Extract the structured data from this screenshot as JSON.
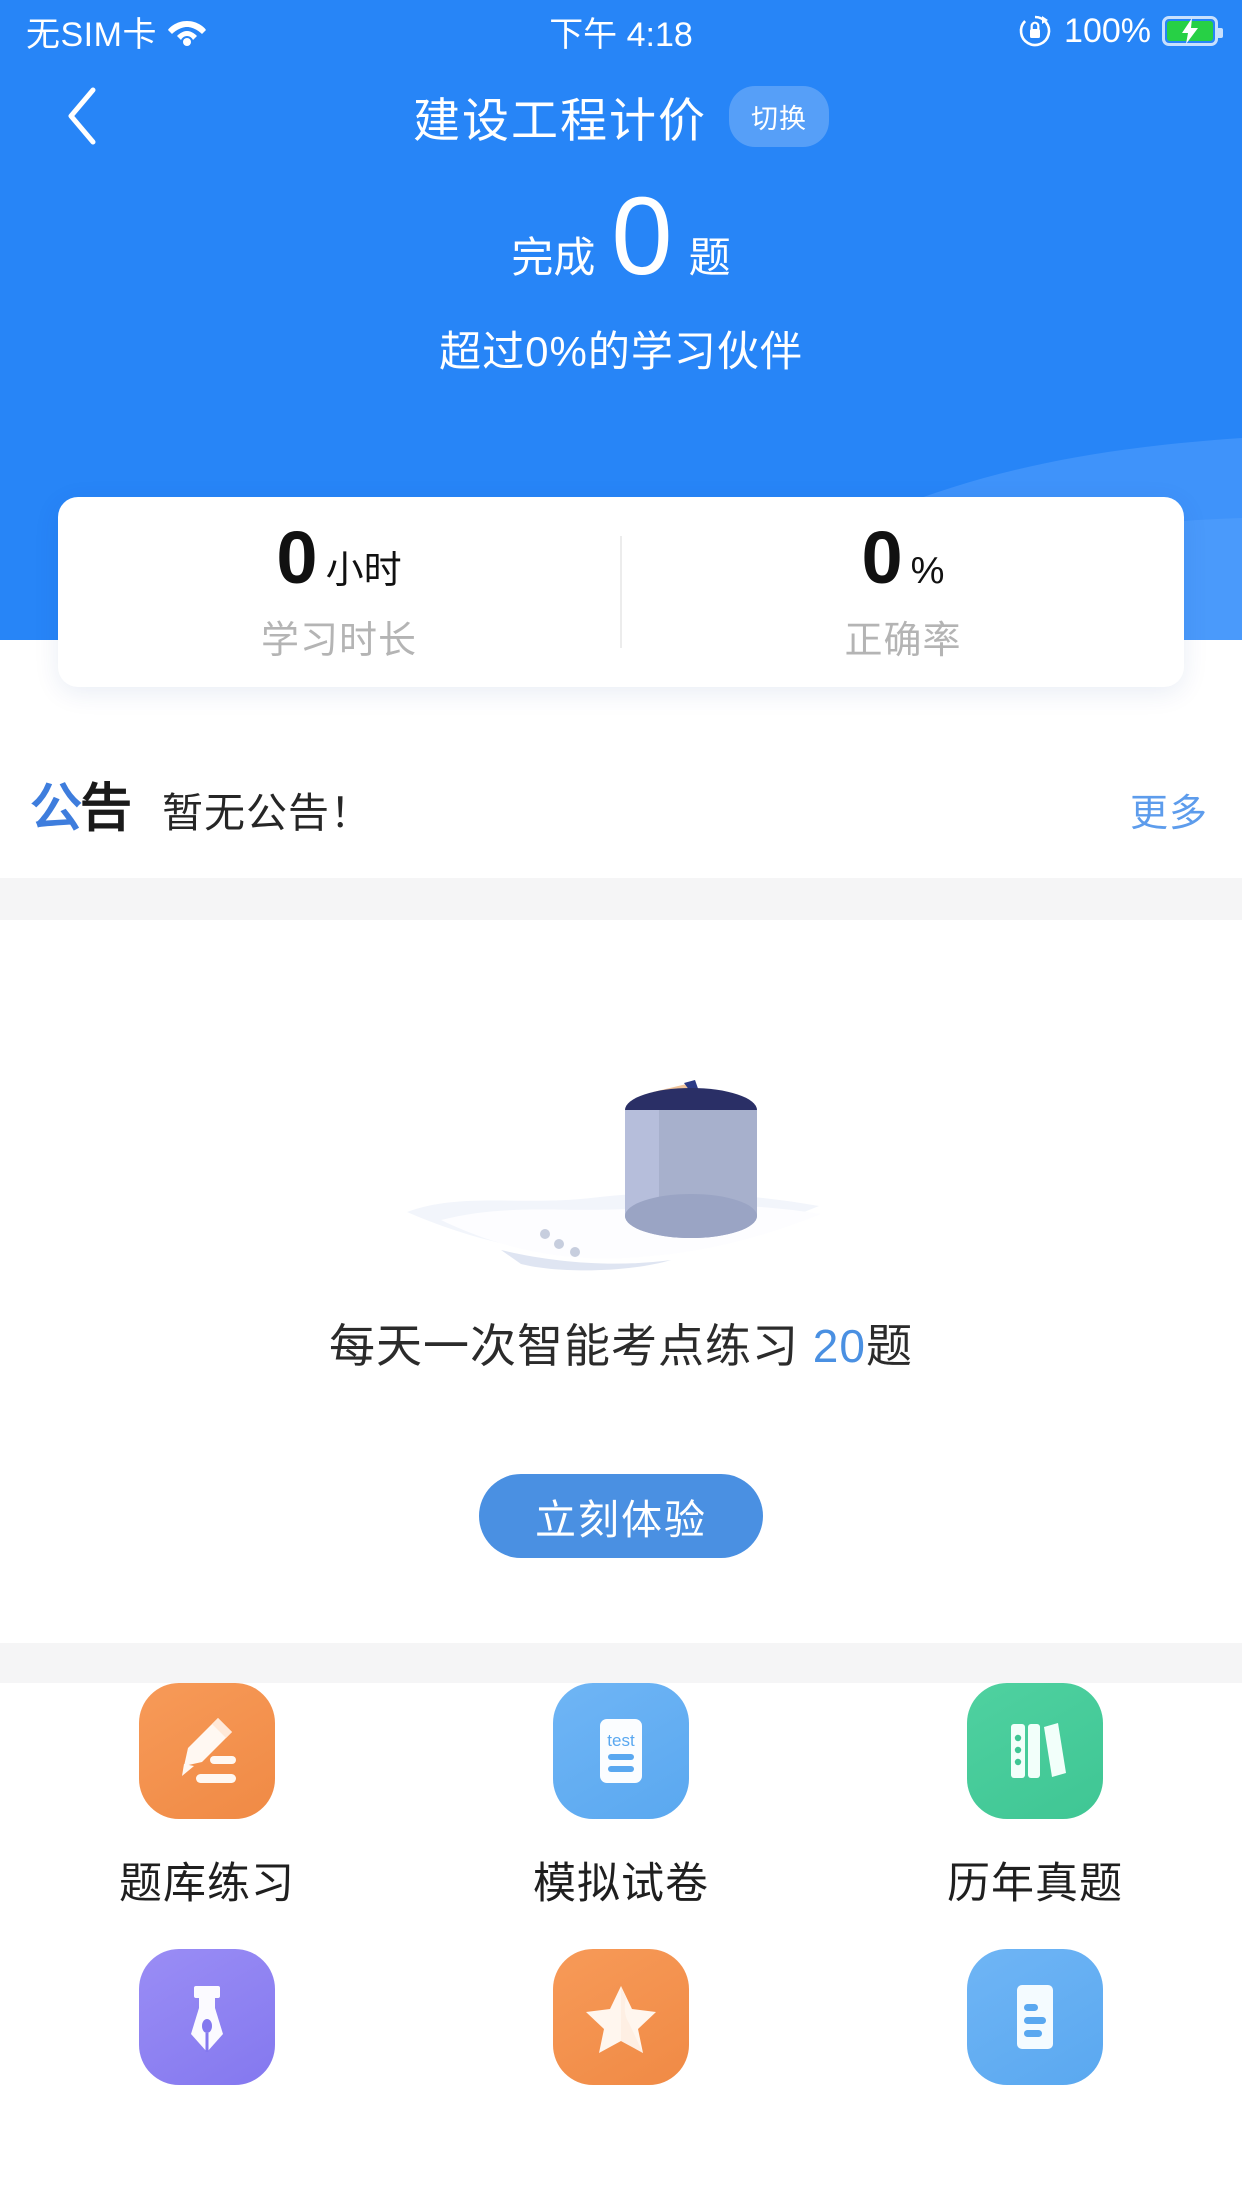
{
  "status_bar": {
    "carrier": "无SIM卡",
    "wifi_icon": "wifi-icon",
    "time": "下午 4:18",
    "rotation_lock_icon": "rotation-lock-icon",
    "battery_percent": "100%",
    "battery_icon": "battery-charging-icon",
    "text_color": "#ffffff"
  },
  "nav": {
    "back_icon": "chevron-left-icon",
    "title": "建设工程计价",
    "switch_label": "切换"
  },
  "hero": {
    "background_color": "#2785f7",
    "done_prefix": "完成",
    "done_count": "0",
    "done_suffix": "题",
    "subtitle": "超过0%的学习伙伴"
  },
  "stats": {
    "items": [
      {
        "value": "0",
        "unit": "小时",
        "label": "学习时长"
      },
      {
        "value": "0",
        "unit": "%",
        "label": "正确率"
      }
    ]
  },
  "announcement": {
    "logo_char_1": "公",
    "logo_char_2": "告",
    "text": "暂无公告！",
    "more_label": "更多",
    "more_color": "#5d9cec"
  },
  "daily_practice": {
    "illustration_icon": "pencil-in-cup-illustration",
    "text_prefix": "每天一次智能考点练习 ",
    "highlight": "20",
    "text_suffix": "题",
    "highlight_color": "#4a90e2",
    "button_label": "立刻体验",
    "button_color": "#4a90e2"
  },
  "grid": {
    "items": [
      {
        "label": "题库练习",
        "icon": "pencil-edit-icon",
        "color_start": "#f79a58",
        "color_end": "#f08a45"
      },
      {
        "label": "模拟试卷",
        "icon": "test-paper-icon",
        "color_start": "#6fb5f5",
        "color_end": "#5aa8f0"
      },
      {
        "label": "历年真题",
        "icon": "books-icon",
        "color_start": "#4fd1a0",
        "color_end": "#3fc694"
      },
      {
        "label": "",
        "icon": "fountain-pen-icon",
        "color_start": "#9a8df5",
        "color_end": "#8478ef"
      },
      {
        "label": "",
        "icon": "star-icon",
        "color_start": "#f79a58",
        "color_end": "#f08a45"
      },
      {
        "label": "",
        "icon": "document-lines-icon",
        "color_start": "#6fb5f5",
        "color_end": "#5aa8f0"
      }
    ]
  }
}
